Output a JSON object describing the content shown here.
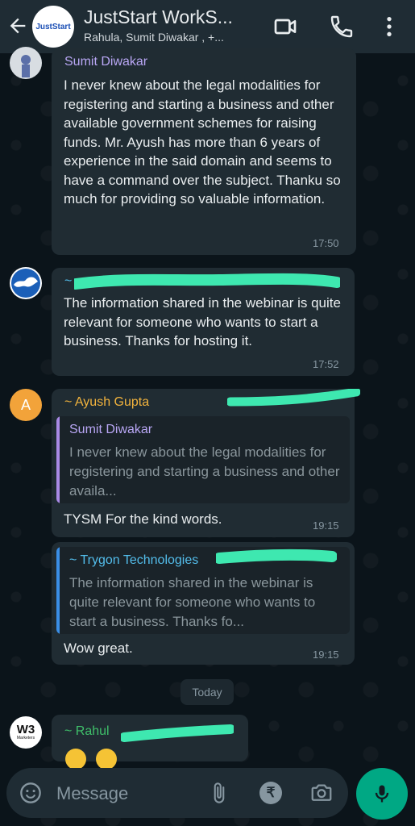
{
  "header": {
    "title": "JustStart WorkS...",
    "subtitle": "Rahula, Sumit Diwakar , +...",
    "group_avatar_text": "JustStart",
    "back_icon": "arrow-left-icon",
    "video_icon": "video-call-icon",
    "call_icon": "phone-icon",
    "menu_icon": "more-vertical-icon"
  },
  "messages": [
    {
      "sender": "Sumit Diwakar",
      "text": "I never knew about the legal modalities for registering and starting a business and other available government schemes for raising funds. Mr. Ayush has more than 6 years of experience in the said domain and seems to have a command over the subject. Thanku so much for providing so valuable information.",
      "time": "17:50",
      "sender_color": "#b9a7f5"
    },
    {
      "sender": "~",
      "text": "The information shared in the webinar is quite relevant for someone who wants to start a business. Thanks for hosting it.",
      "time": "17:52",
      "sender_color": "#53bdeb"
    },
    {
      "sender": "~ Ayush Gupta",
      "avatar_letter": "A",
      "quote": {
        "name": "Sumit Diwakar",
        "text": "I never knew about the legal modalities for registering and starting a business and other availa..."
      },
      "text": "TYSM For the kind words.",
      "time": "19:15",
      "sender_color": "#f2b33d"
    },
    {
      "quote": {
        "name": "~ Trygon Technologies",
        "text": "The information shared in the webinar is quite relevant for someone who wants to start a business. Thanks fo..."
      },
      "text": "Wow great.",
      "time": "19:15"
    },
    {
      "sender": "~ Rahul",
      "avatar_text": "W3",
      "avatar_subtext": "Marketers",
      "sender_color": "#3fbf6a"
    }
  ],
  "date_separator": "Today",
  "input": {
    "placeholder": "Message",
    "emoji_icon": "emoji-icon",
    "attach_icon": "paperclip-icon",
    "payment_icon": "rupee-icon",
    "camera_icon": "camera-icon",
    "mic_icon": "microphone-icon"
  },
  "colors": {
    "header_bg": "#1f2c34",
    "bubble_bg": "#202c33",
    "accent_green": "#00a884",
    "redaction": "#3ee8b0"
  }
}
